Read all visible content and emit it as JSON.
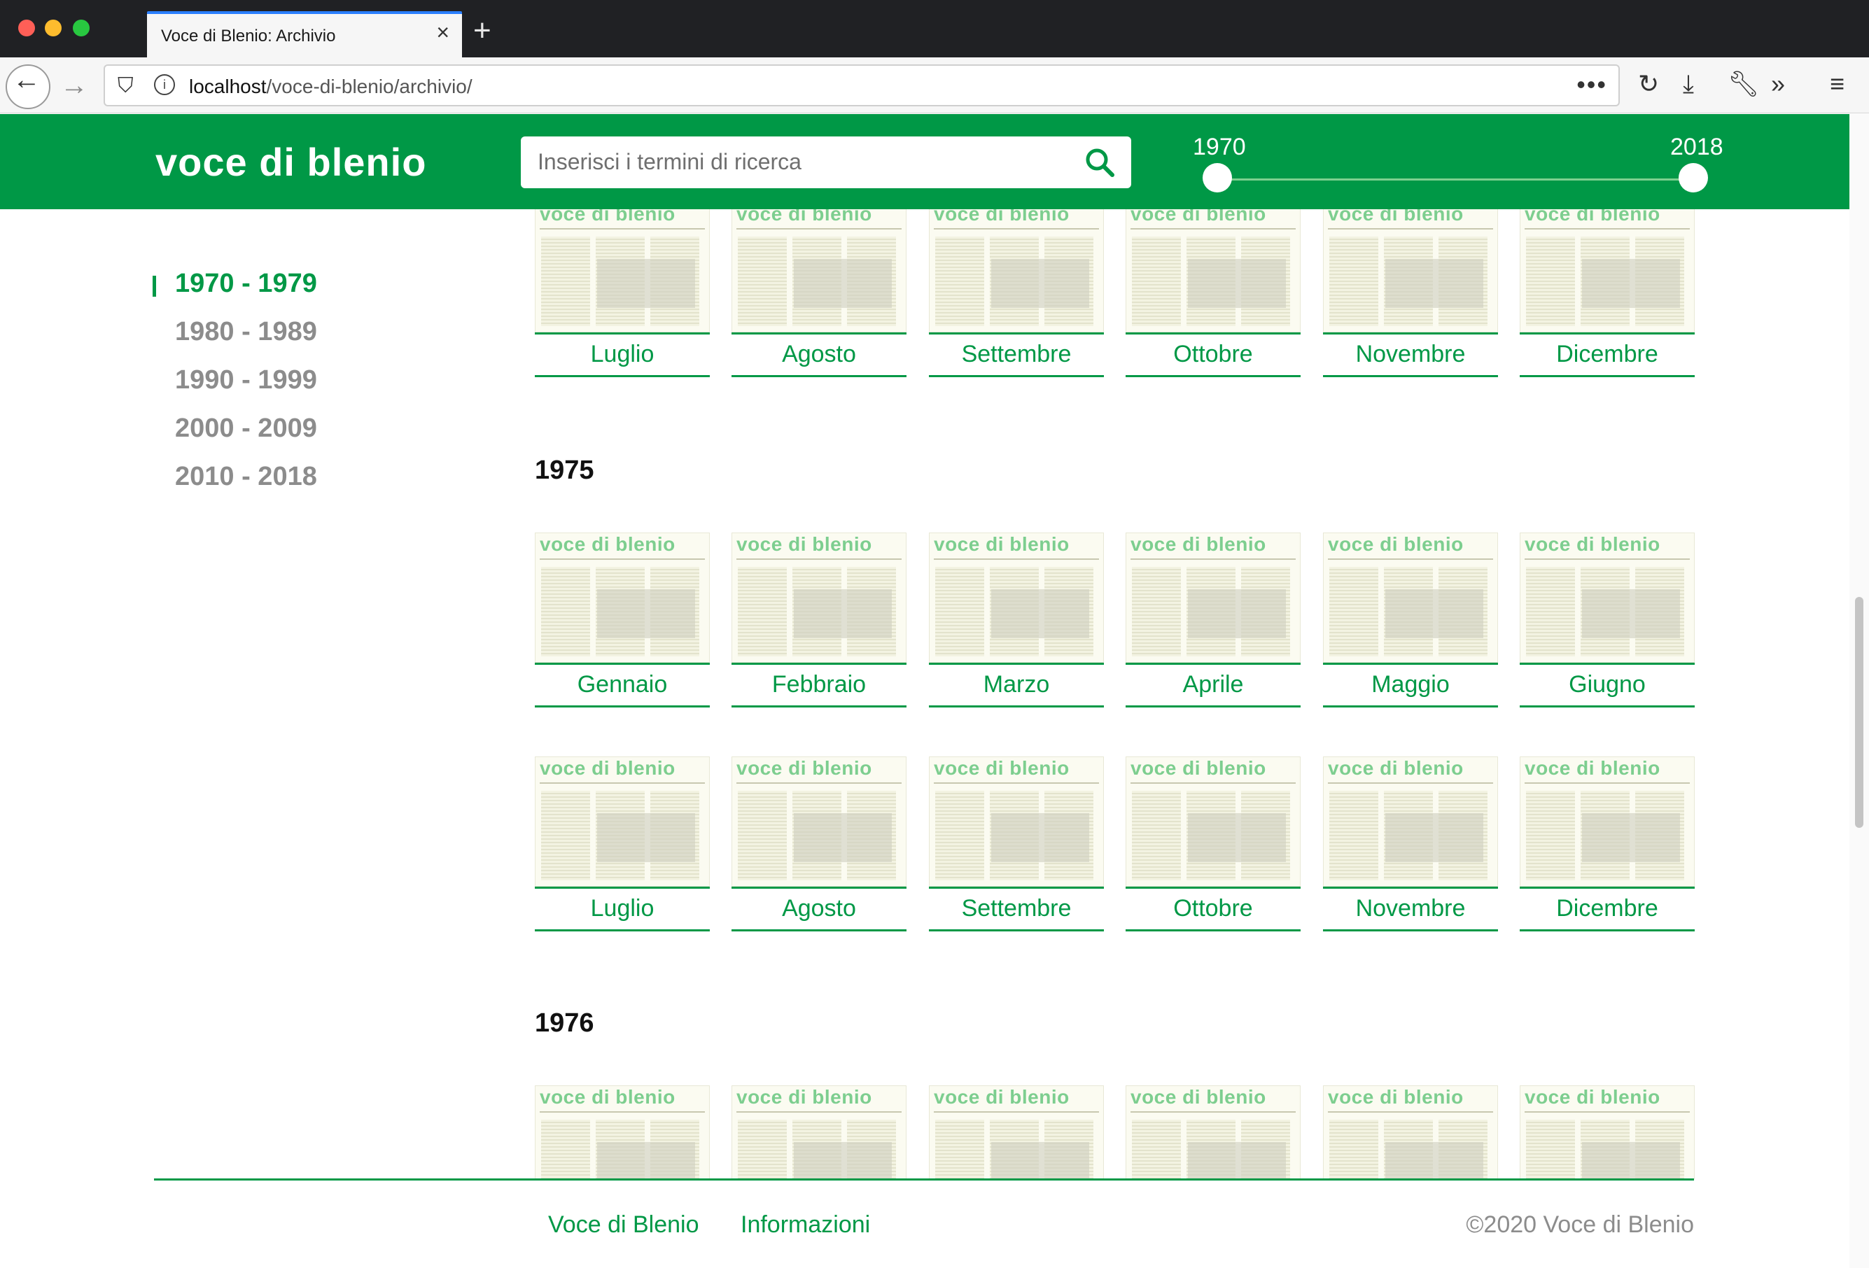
{
  "browser": {
    "tab_title": "Voce di Blenio: Archivio",
    "url_host": "localhost",
    "url_path": "/voce-di-blenio/archivio/"
  },
  "header": {
    "logo": "voce di blenio",
    "search_placeholder": "Inserisci i termini di ricerca",
    "range_from": "1970",
    "range_to": "2018"
  },
  "decades": [
    "1970 - 1979",
    "1980 - 1989",
    "1990 - 1999",
    "2000 - 2009",
    "2010 - 2018"
  ],
  "active_decade": "1970 - 1979",
  "masthead": "voce di blenio",
  "rows": [
    {
      "year": "",
      "months": [
        "Luglio",
        "Agosto",
        "Settembre",
        "Ottobre",
        "Novembre",
        "Dicembre"
      ]
    },
    {
      "year": "1975",
      "months": [
        "Gennaio",
        "Febbraio",
        "Marzo",
        "Aprile",
        "Maggio",
        "Giugno"
      ]
    },
    {
      "year": "",
      "months": [
        "Luglio",
        "Agosto",
        "Settembre",
        "Ottobre",
        "Novembre",
        "Dicembre"
      ]
    },
    {
      "year": "1976",
      "months": []
    }
  ],
  "footer": {
    "link1": "Voce di Blenio",
    "link2": "Informazioni",
    "copyright": "©2020 Voce di Blenio"
  },
  "colors": {
    "brand": "#009846",
    "inactive": "#8c8c8c"
  }
}
